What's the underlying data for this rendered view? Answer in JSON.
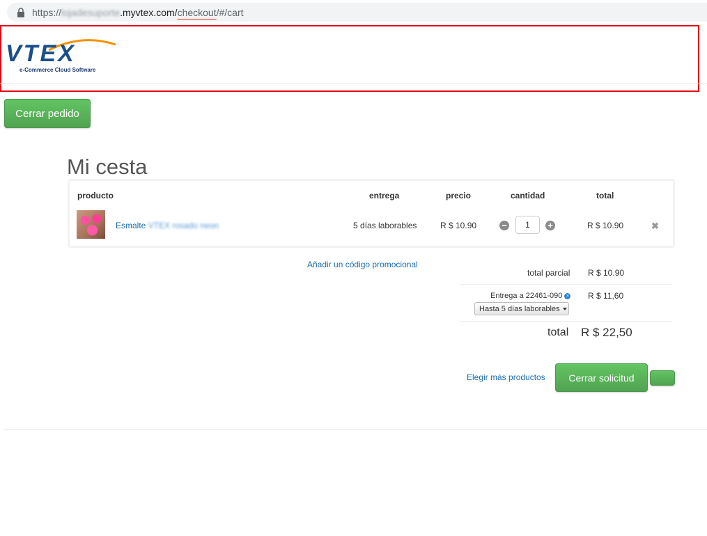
{
  "browser": {
    "url_prefix": "https://",
    "url_blurred": "lojadesuporte",
    "url_domain": ".myvtex.com/",
    "url_highlight": "checkout",
    "url_suffix": "/#/cart"
  },
  "header": {
    "logo_word": "VTEX",
    "logo_tagline": "e-Commerce Cloud Software"
  },
  "actions": {
    "close_order_label": "Cerrar pedido",
    "checkout_label": "Cerrar solicitud",
    "more_products_label": "Elegir más productos"
  },
  "page": {
    "title": "Mi cesta"
  },
  "cart": {
    "columns": {
      "product": "producto",
      "delivery": "entrega",
      "price": "precio",
      "quantity": "cantidad",
      "total": "total"
    },
    "items": [
      {
        "name": "Esmalte",
        "name_blurred": "VTEX rosado neon",
        "delivery": "5 días laborables",
        "price": "R $ 10.90",
        "quantity": "1",
        "total": "R $ 10.90"
      }
    ]
  },
  "summary": {
    "promo_link": "Añadir un código promocional",
    "subtotal_label": "total parcial",
    "subtotal_value": "R $ 10.90",
    "shipping_label": "Entrega a 22461-090",
    "shipping_value": "R $ 11,60",
    "shipping_option": "Hasta 5 días laborables",
    "total_label": "total",
    "total_value": "R $ 22,50"
  },
  "colors": {
    "brand_blue": "#1c4f8a",
    "accent_green": "#5cb85c",
    "link_blue": "#1a6cb0",
    "highlight_red": "#e30613"
  }
}
